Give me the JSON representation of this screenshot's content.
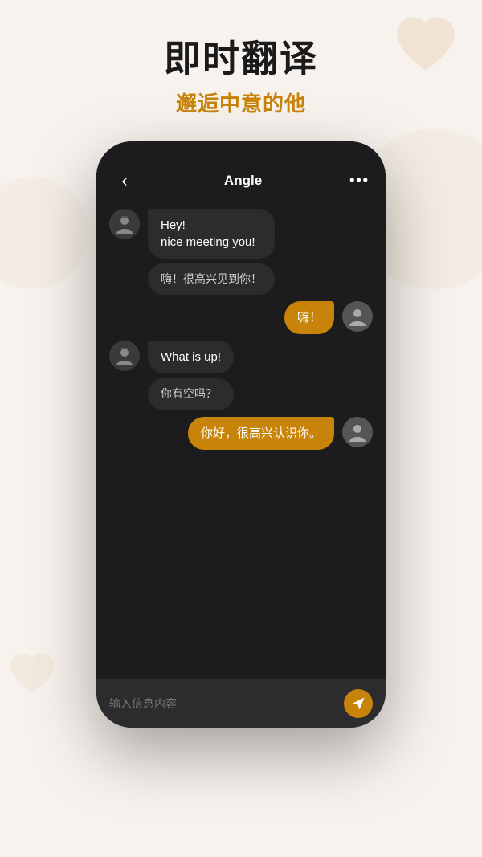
{
  "page": {
    "bg_color": "#f7f2ed",
    "title_main": "即时翻译",
    "title_sub": "邂逅中意的他"
  },
  "chat": {
    "contact_name": "Angle",
    "back_label": "‹",
    "more_label": "•••",
    "messages": [
      {
        "id": 1,
        "side": "left",
        "text": "Hey!\nnice meeting you!",
        "translation": "嗨！很高兴见到你！"
      },
      {
        "id": 2,
        "side": "right",
        "text": "嗨！"
      },
      {
        "id": 3,
        "side": "left",
        "text": "What is up!",
        "translation": "你有空吗？"
      },
      {
        "id": 4,
        "side": "right",
        "text": "你好，很高兴认识你。"
      }
    ],
    "input_placeholder": "输入信息内容"
  }
}
